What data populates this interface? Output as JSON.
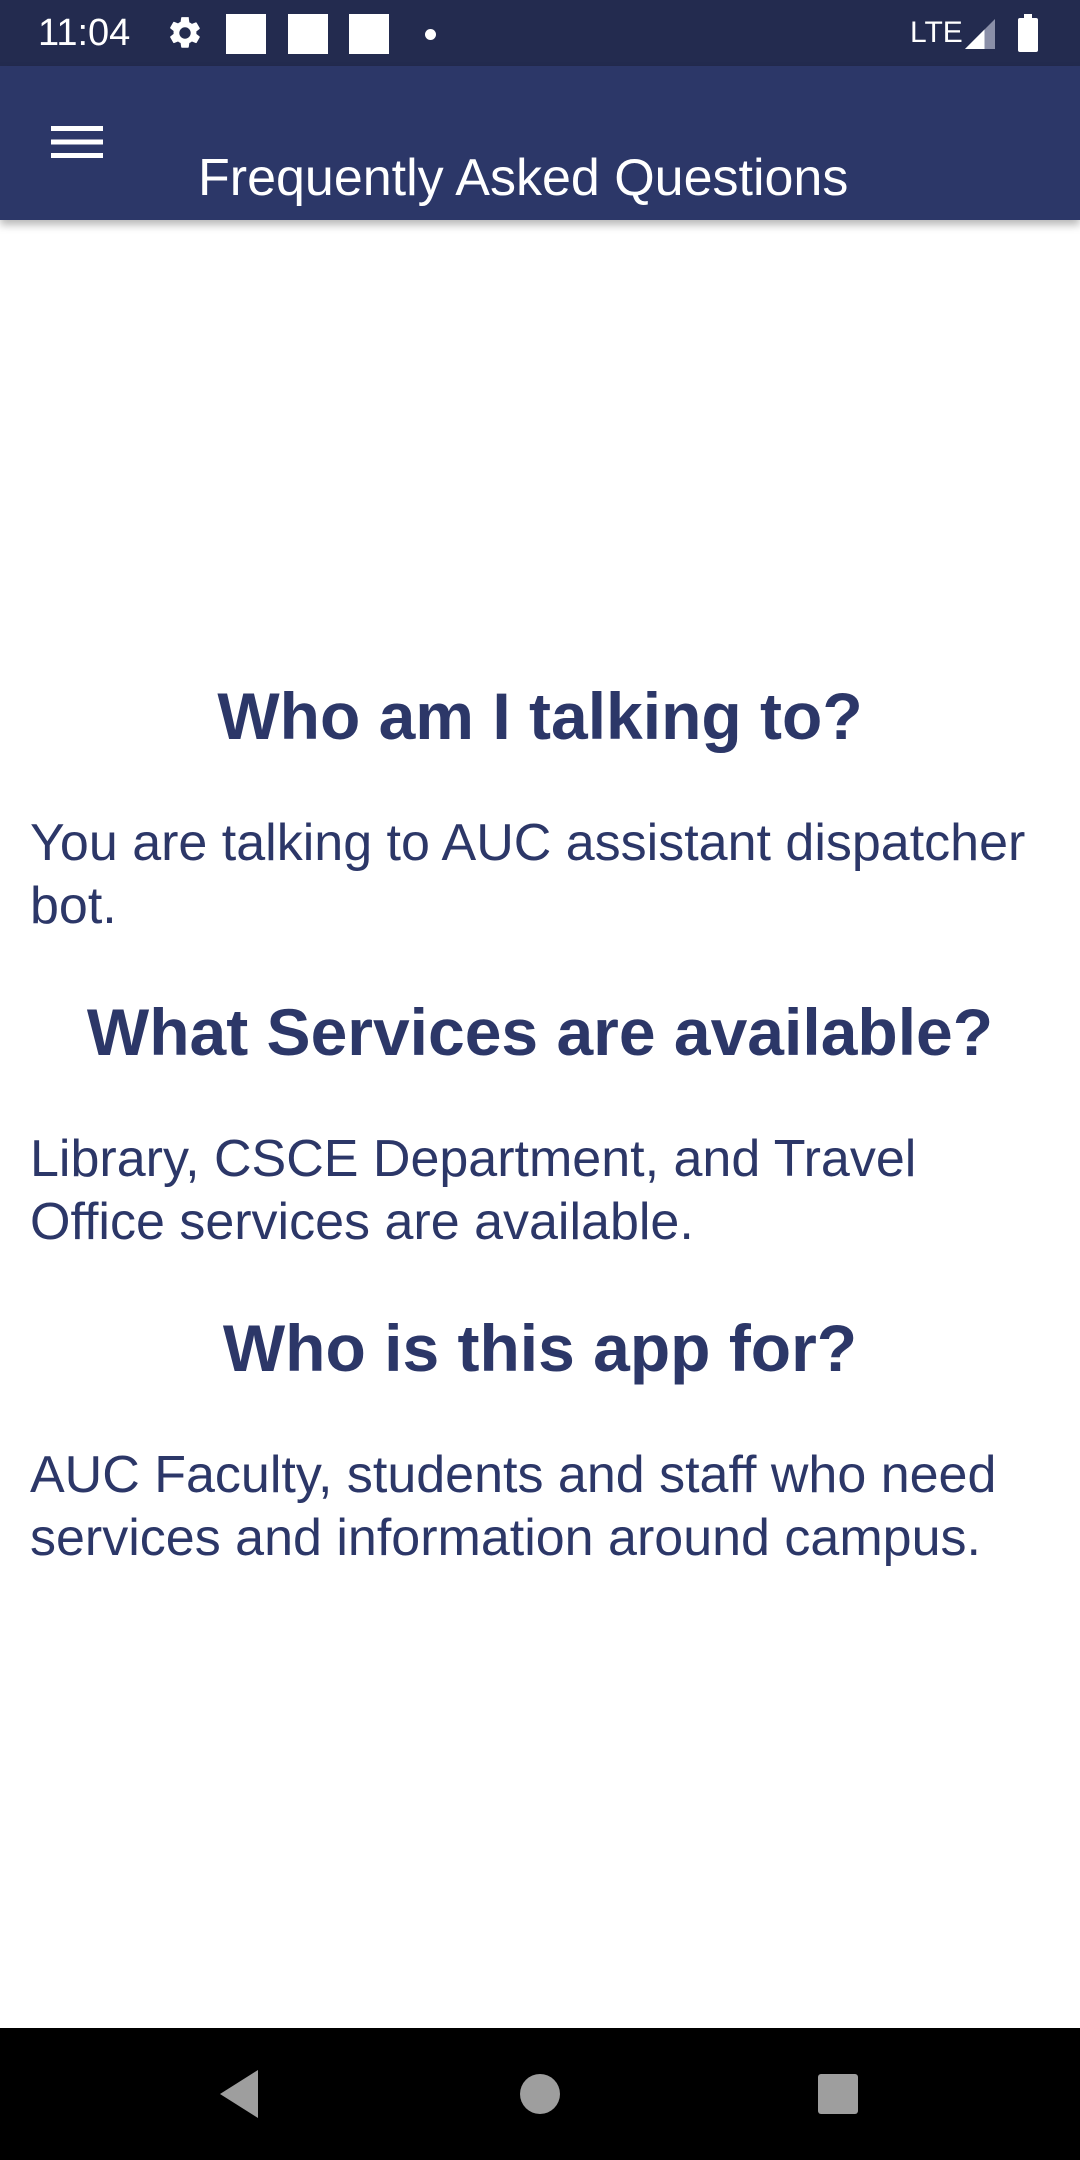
{
  "status_bar": {
    "time": "11:04",
    "network": "LTE",
    "icons": [
      "gear-icon",
      "notification-square-icon",
      "notification-square-icon",
      "notification-square-icon",
      "more-dot-icon",
      "signal-icon",
      "battery-icon"
    ]
  },
  "app_bar": {
    "menu_icon": "hamburger-menu-icon",
    "title": "Frequently Asked Questions"
  },
  "faq": [
    {
      "question": "Who am I talking to?",
      "answer": "You are talking to AUC assistant dispatcher bot."
    },
    {
      "question": "What Services are available?",
      "answer": "Library, CSCE Department, and Travel Office services are available."
    },
    {
      "question": "Who is this app for?",
      "answer": "AUC Faculty, students and staff who need services and information around campus."
    }
  ],
  "nav_bar": {
    "icons": [
      "back-icon",
      "home-icon",
      "recents-icon"
    ]
  },
  "colors": {
    "status_bar": "#232b4f",
    "app_bar": "#2c3768",
    "text": "#2c3768",
    "background": "#ffffff",
    "nav_bar": "#000000"
  }
}
